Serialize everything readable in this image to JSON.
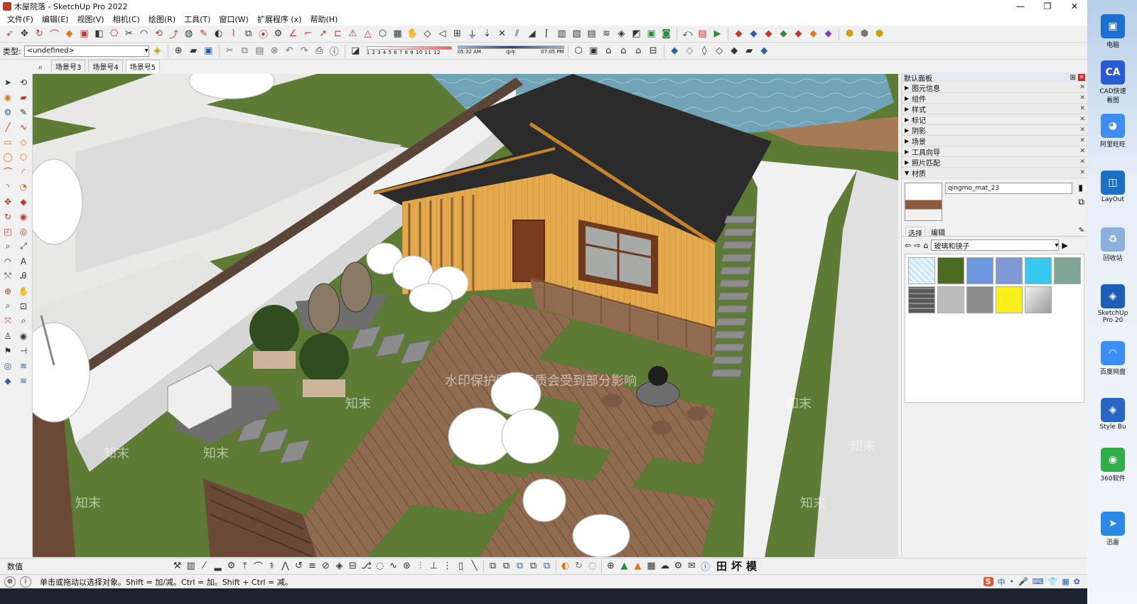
{
  "window": {
    "title": "木屋院落 - SketchUp Pro 2022",
    "controls": [
      "—",
      "❐",
      "✕"
    ]
  },
  "menu": [
    "文件(F)",
    "编辑(E)",
    "视图(V)",
    "相机(C)",
    "绘图(R)",
    "工具(T)",
    "窗口(W)",
    "扩展程序 (x)",
    "帮助(H)"
  ],
  "toolbar2": {
    "type_label": "类型:",
    "type_value": "<undefined>",
    "shadow_scale_numbers": "1 2 3 4 5 6 7 8 9 10 11 12",
    "time_left": "05:32 AM",
    "time_mid": "中午",
    "time_right": "07:05 PM"
  },
  "scenes": [
    "场景号3",
    "场景号4",
    "场景号5"
  ],
  "active_scene": "场景号5",
  "watermarks": [
    "水印保护区，画质会受到部分影响",
    "知末",
    "知末",
    "知末",
    "知末",
    "知末",
    "知末",
    "知末"
  ],
  "tray": {
    "title": "默认面板",
    "panels": [
      "图元信息",
      "组件",
      "样式",
      "标记",
      "阴影",
      "场景",
      "工具向导",
      "照片匹配",
      "材质"
    ],
    "material_name": "qingmo_mat_23",
    "tabs": [
      "选择",
      "编辑"
    ],
    "library": "玻璃和镜子",
    "swatch_colors": [
      "#cfe6f4",
      "#4c6a22",
      "#6f97e0",
      "#7f99d6",
      "#36c8ee",
      "#7ea596",
      "#565656",
      "#bcbcbc",
      "#8c8c8c",
      "#f7ee1a",
      "#d4d4d4"
    ]
  },
  "vcb": {
    "label": "数值"
  },
  "status": {
    "message": "单击或拖动以选择对象。Shift = 加/减。Ctrl = 加。Shift + Ctrl = 减。",
    "glyphs": [
      "田",
      "坏",
      "模"
    ],
    "ime": [
      "S",
      "中",
      "•",
      "🎤",
      "⌨",
      "👕",
      "▦",
      "✿"
    ]
  },
  "desktop": [
    {
      "label": "电脑",
      "color": "#1f6fd1",
      "glyph": "▣"
    },
    {
      "label": "CAD快速看图",
      "color": "#2a5bd7",
      "glyph": "CA"
    },
    {
      "label": "阿里旺旺",
      "color": "#3d8ef0",
      "glyph": "◕"
    },
    {
      "label": "LayOut",
      "color": "#1c6fc5",
      "glyph": "◫"
    },
    {
      "label": "回收站",
      "color": "#8ab0dc",
      "glyph": "♻"
    },
    {
      "label": "SketchUp Pro 20",
      "color": "#1b5fb8",
      "glyph": "◈"
    },
    {
      "label": "百度网盘",
      "color": "#3a8ef5",
      "glyph": "◠"
    },
    {
      "label": "Style Bu",
      "color": "#2766c2",
      "glyph": "◈"
    },
    {
      "label": "360软件",
      "color": "#2fae4a",
      "glyph": "◉"
    },
    {
      "label": "迅雷",
      "color": "#2a8be6",
      "glyph": "➤"
    }
  ]
}
